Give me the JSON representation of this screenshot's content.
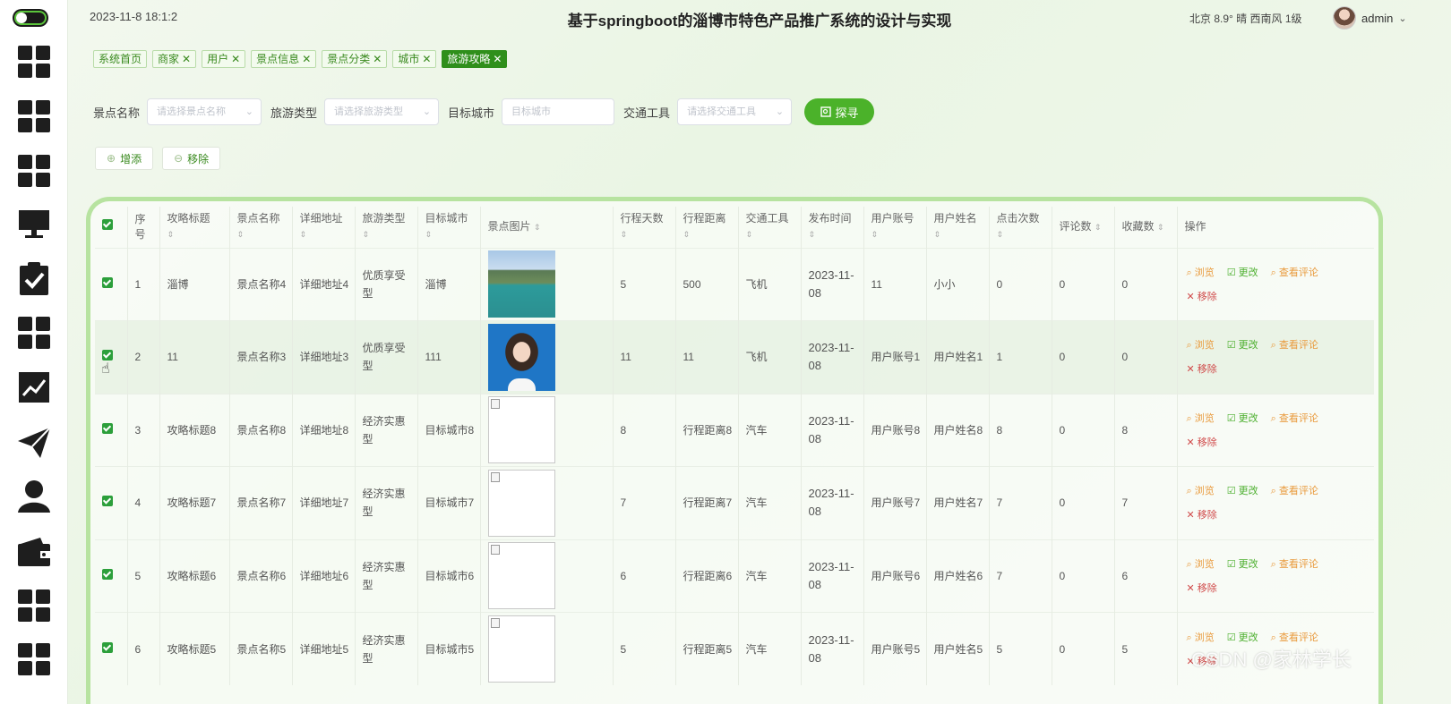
{
  "header": {
    "datetime": "2023-11-8 18:1:2",
    "title": "基于springboot的淄博市特色产品推广系统的设计与实现",
    "weather": "北京  8.9°  晴  西南风  1级",
    "username": "admin",
    "user_caret": "⌄"
  },
  "sidebar": {
    "icons": [
      "toggle-icon",
      "grid-icon",
      "grid-icon",
      "grid-icon",
      "monitor-icon",
      "clipboard-check-icon",
      "grid-icon",
      "chart-icon",
      "paper-plane-icon",
      "user-icon",
      "wallet-icon",
      "grid-icon",
      "grid-icon"
    ]
  },
  "tags": [
    {
      "label": "系统首页",
      "closable": false,
      "active": false
    },
    {
      "label": "商家",
      "closable": true,
      "active": false
    },
    {
      "label": "用户",
      "closable": true,
      "active": false
    },
    {
      "label": "景点信息",
      "closable": true,
      "active": false
    },
    {
      "label": "景点分类",
      "closable": true,
      "active": false
    },
    {
      "label": "城市",
      "closable": true,
      "active": false
    },
    {
      "label": "旅游攻略",
      "closable": true,
      "active": true
    }
  ],
  "search": {
    "spot_label": "景点名称",
    "spot_placeholder": "请选择景点名称",
    "type_label": "旅游类型",
    "type_placeholder": "请选择旅游类型",
    "city_label": "目标城市",
    "city_placeholder": "目标城市",
    "transport_label": "交通工具",
    "transport_placeholder": "请选择交通工具",
    "button": "探寻"
  },
  "actions": {
    "add": "增添",
    "remove": "移除"
  },
  "table": {
    "headers": {
      "index": "序号",
      "title": "攻略标题",
      "spot": "景点名称",
      "address": "详细地址",
      "type": "旅游类型",
      "city": "目标城市",
      "image": "景点图片",
      "days": "行程天数",
      "distance": "行程距离",
      "transport": "交通工具",
      "publish": "发布时间",
      "account": "用户账号",
      "uname": "用户姓名",
      "clicks": "点击次数",
      "comments": "评论数",
      "favorites": "收藏数",
      "ops": "操作"
    },
    "ops": {
      "view": "浏览",
      "edit": "更改",
      "comments": "查看评论",
      "delete": "移除"
    },
    "rows": [
      {
        "index": "1",
        "title": "淄博",
        "spot": "景点名称4",
        "address": "详细地址4",
        "type": "优质享受型",
        "city": "淄博",
        "image": "lake",
        "days": "5",
        "distance": "500",
        "transport": "飞机",
        "publish": "2023-11-08",
        "account": "11",
        "uname": "小小",
        "clicks": "0",
        "comments": "0",
        "favorites": "0"
      },
      {
        "index": "2",
        "title": "11",
        "spot": "景点名称3",
        "address": "详细地址3",
        "type": "优质享受型",
        "city": "111",
        "image": "portrait",
        "days": "11",
        "distance": "11",
        "transport": "飞机",
        "publish": "2023-11-08",
        "account": "用户账号1",
        "uname": "用户姓名1",
        "clicks": "1",
        "comments": "0",
        "favorites": "0"
      },
      {
        "index": "3",
        "title": "攻略标题8",
        "spot": "景点名称8",
        "address": "详细地址8",
        "type": "经济实惠型",
        "city": "目标城市8",
        "image": "broken",
        "days": "8",
        "distance": "行程距离8",
        "transport": "汽车",
        "publish": "2023-11-08",
        "account": "用户账号8",
        "uname": "用户姓名8",
        "clicks": "8",
        "comments": "0",
        "favorites": "8"
      },
      {
        "index": "4",
        "title": "攻略标题7",
        "spot": "景点名称7",
        "address": "详细地址7",
        "type": "经济实惠型",
        "city": "目标城市7",
        "image": "broken",
        "days": "7",
        "distance": "行程距离7",
        "transport": "汽车",
        "publish": "2023-11-08",
        "account": "用户账号7",
        "uname": "用户姓名7",
        "clicks": "7",
        "comments": "0",
        "favorites": "7"
      },
      {
        "index": "5",
        "title": "攻略标题6",
        "spot": "景点名称6",
        "address": "详细地址6",
        "type": "经济实惠型",
        "city": "目标城市6",
        "image": "broken",
        "days": "6",
        "distance": "行程距离6",
        "transport": "汽车",
        "publish": "2023-11-08",
        "account": "用户账号6",
        "uname": "用户姓名6",
        "clicks": "7",
        "comments": "0",
        "favorites": "6"
      },
      {
        "index": "6",
        "title": "攻略标题5",
        "spot": "景点名称5",
        "address": "详细地址5",
        "type": "经济实惠型",
        "city": "目标城市5",
        "image": "broken",
        "days": "5",
        "distance": "行程距离5",
        "transport": "汽车",
        "publish": "2023-11-08",
        "account": "用户账号5",
        "uname": "用户姓名5",
        "clicks": "5",
        "comments": "0",
        "favorites": "5"
      }
    ]
  },
  "watermark": "CSDN @家林学长",
  "colors": {
    "accent": "#4bb22a",
    "active_tag": "#2f8f1b",
    "view": "#e99a3c",
    "edit": "#4caf2e",
    "delete": "#d04a4a"
  }
}
